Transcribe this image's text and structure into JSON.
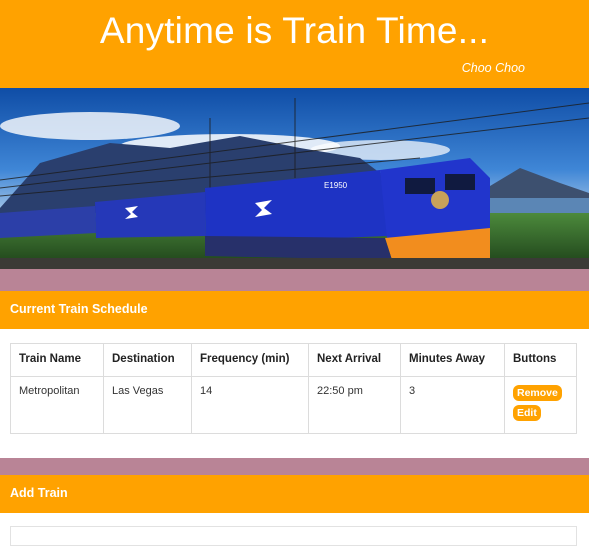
{
  "header": {
    "title": "Anytime is Train Time...",
    "subtitle": "Choo Choo"
  },
  "colors": {
    "accent": "#ffa200",
    "divider": "#b98496"
  },
  "banner": {
    "train_number": "E1950"
  },
  "schedule": {
    "heading": "Current Train Schedule",
    "columns": [
      "Train Name",
      "Destination",
      "Frequency (min)",
      "Next Arrival",
      "Minutes Away",
      "Buttons"
    ],
    "rows": [
      {
        "name": "Metropolitan",
        "destination": "Las Vegas",
        "frequency": "14",
        "next_arrival": "22:50 pm",
        "minutes_away": "3",
        "remove_label": "Remove",
        "edit_label": "Edit"
      }
    ]
  },
  "add_train": {
    "heading": "Add Train"
  }
}
